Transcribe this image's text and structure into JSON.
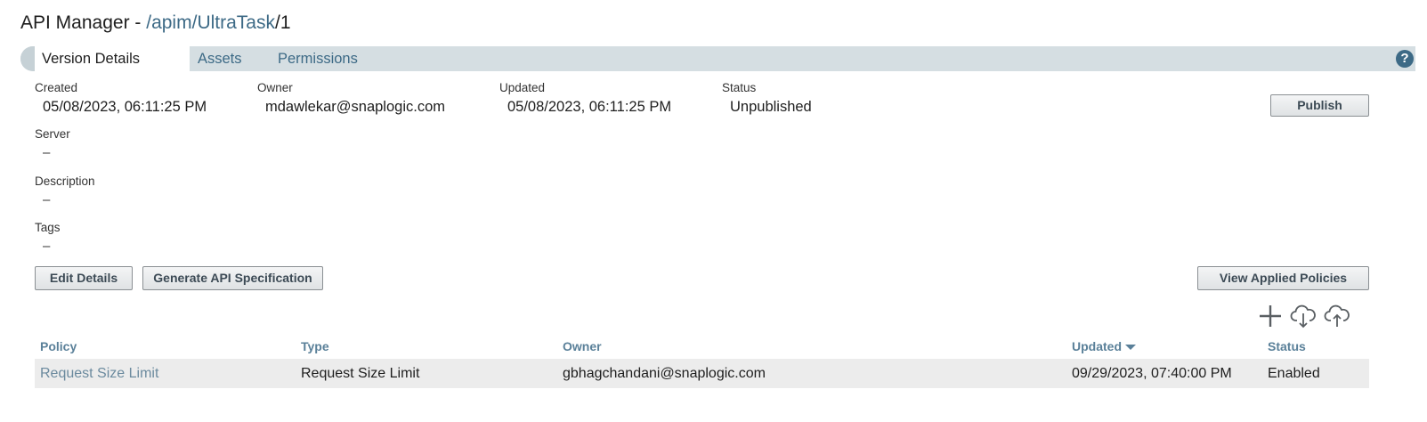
{
  "header": {
    "prefix": "API Manager - ",
    "crumb_slash1": "/",
    "crumb_apim": "apim",
    "crumb_slash2": "/",
    "crumb_task": "UltraTask",
    "crumb_slash3": "/",
    "crumb_version": "1"
  },
  "tabs": {
    "version_details": "Version Details",
    "assets": "Assets",
    "permissions": "Permissions"
  },
  "help_icon": "?",
  "details": {
    "created_label": "Created",
    "created_value": "05/08/2023, 06:11:25 PM",
    "owner_label": "Owner",
    "owner_value": "mdawlekar@snaplogic.com",
    "updated_label": "Updated",
    "updated_value": "05/08/2023, 06:11:25 PM",
    "status_label": "Status",
    "status_value": "Unpublished",
    "server_label": "Server",
    "server_value": "–",
    "description_label": "Description",
    "description_value": "–",
    "tags_label": "Tags",
    "tags_value": "–"
  },
  "buttons": {
    "publish": "Publish",
    "edit_details": "Edit Details",
    "generate_spec": "Generate API Specification",
    "view_policies": "View Applied Policies"
  },
  "toolbar_icons": [
    "plus-icon",
    "cloud-download-icon",
    "cloud-upload-icon"
  ],
  "table": {
    "headers": {
      "policy": "Policy",
      "type": "Type",
      "owner": "Owner",
      "updated": "Updated",
      "status": "Status"
    },
    "rows": [
      {
        "policy": "Request Size Limit",
        "type": "Request Size Limit",
        "owner": "gbhagchandani@snaplogic.com",
        "updated": "09/29/2023, 07:40:00 PM",
        "status": "Enabled"
      }
    ]
  },
  "colors": {
    "accent": "#3d6a86",
    "tabbar": "#d5dee2",
    "row_bg": "#ececec",
    "header_text": "#5a8099"
  }
}
